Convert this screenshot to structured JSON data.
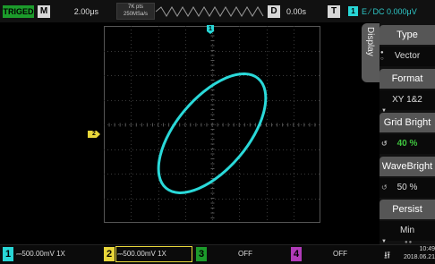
{
  "topbar": {
    "trigger_status": "TRIGED",
    "mode_label": "M",
    "timebase": "2.00μs",
    "memory_depth": "7K pts",
    "sample_rate": "250MSa/s",
    "delay_label": "D",
    "delay_value": "0.00s",
    "trigger_label": "T",
    "trigger_channel": "1",
    "trigger_info": "E ⁄ DC 0.000μV"
  },
  "screen": {
    "ch1_marker": "1",
    "ch2_marker": "2",
    "trace_color": "#2ad9d9",
    "grid_color": "#3a3a3a"
  },
  "menu": {
    "tab_label": "Display",
    "items": [
      {
        "title": "Type",
        "value": "Vector"
      },
      {
        "title": "Format",
        "value": "XY 1&2"
      },
      {
        "title": "Grid Bright",
        "value": "40 %"
      },
      {
        "title": "WaveBright",
        "value": "50 %"
      },
      {
        "title": "Persist",
        "value": "Min"
      }
    ]
  },
  "bottombar": {
    "channels": [
      {
        "num": "1",
        "text": "⎓500.00mV 1X",
        "color": "#28d6d6"
      },
      {
        "num": "2",
        "text": "⎓500.00mV 1X",
        "color": "#e8d63a"
      },
      {
        "num": "3",
        "text": "OFF",
        "color": "#1c9b2b"
      },
      {
        "num": "4",
        "text": "OFF",
        "color": "#b03bb8"
      }
    ],
    "time": "10:49",
    "date": "2018.06.21"
  }
}
